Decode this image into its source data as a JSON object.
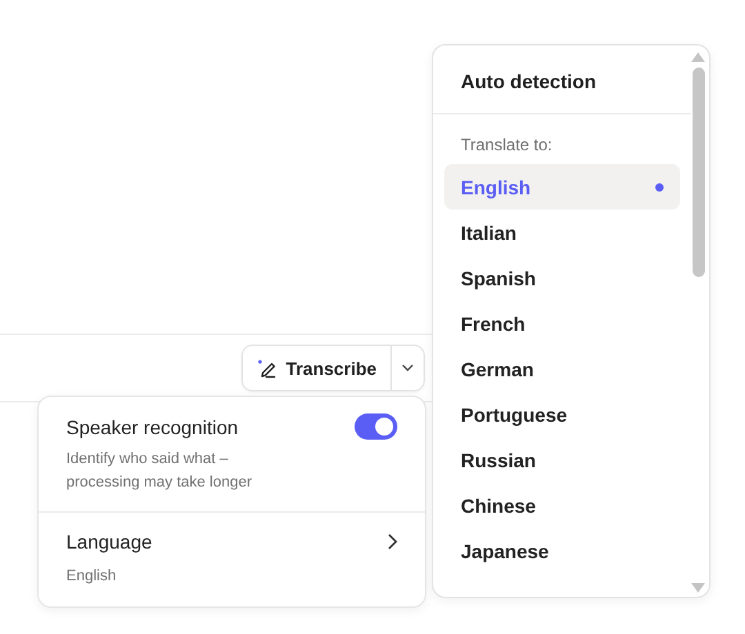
{
  "transcribe_button": {
    "label": "Transcribe"
  },
  "settings_panel": {
    "speaker_recognition": {
      "title": "Speaker recognition",
      "description": "Identify who said what – processing may take longer",
      "on": true
    },
    "language": {
      "title": "Language",
      "value": "English"
    }
  },
  "language_menu": {
    "auto_detection": "Auto detection",
    "section_label": "Translate to:",
    "items": [
      {
        "label": "English",
        "selected": true
      },
      {
        "label": "Italian",
        "selected": false
      },
      {
        "label": "Spanish",
        "selected": false
      },
      {
        "label": "French",
        "selected": false
      },
      {
        "label": "German",
        "selected": false
      },
      {
        "label": "Portuguese",
        "selected": false
      },
      {
        "label": "Russian",
        "selected": false
      },
      {
        "label": "Chinese",
        "selected": false
      },
      {
        "label": "Japanese",
        "selected": false
      }
    ]
  }
}
